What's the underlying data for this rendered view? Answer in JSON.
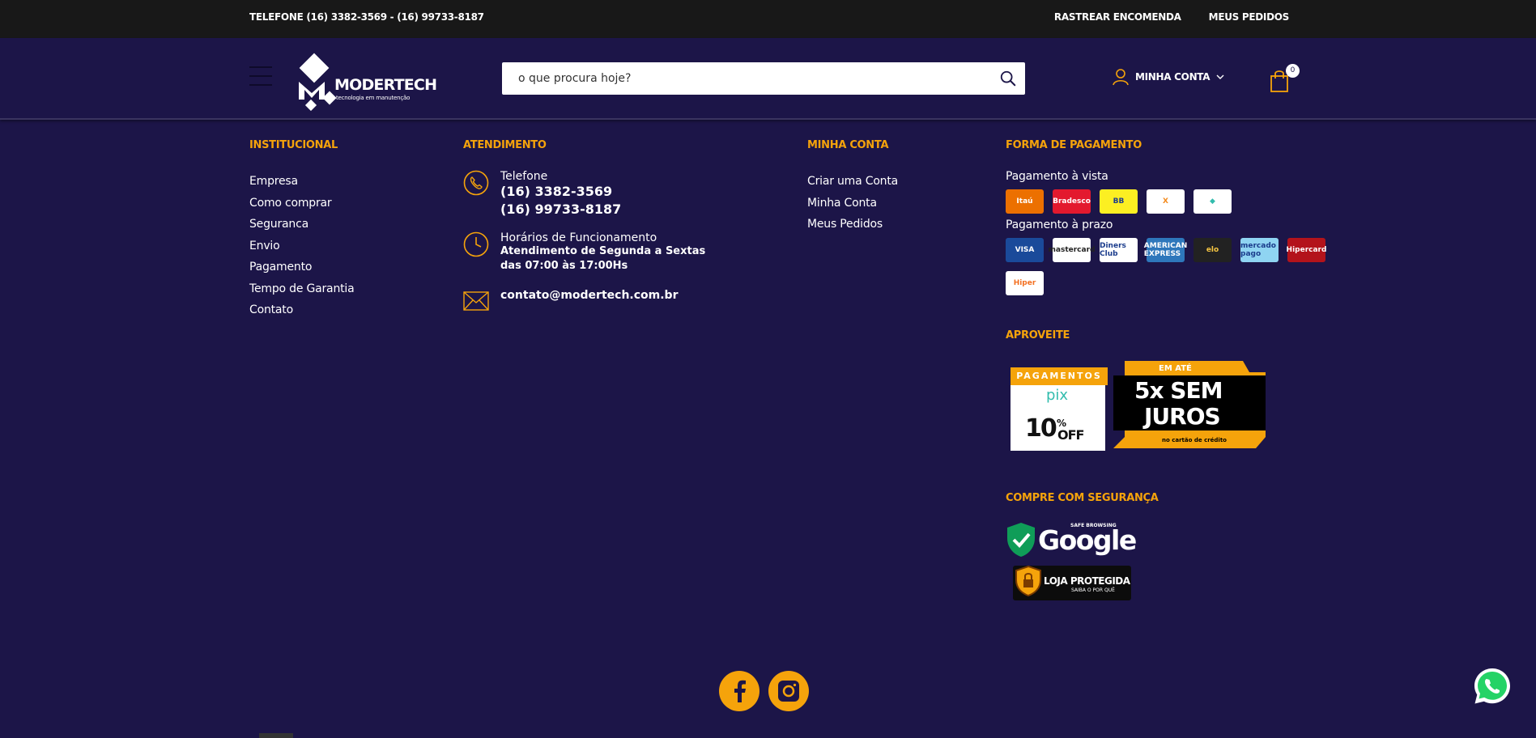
{
  "topbar": {
    "phone": "TELEFONE (16) 3382-3569 - (16) 99733-8187",
    "track_order": "RASTREAR ENCOMENDA",
    "my_orders": "MEUS PEDIDOS"
  },
  "header": {
    "logo_brand": "MODERTECH",
    "logo_tagline": "tecnologia em manutenção",
    "search_placeholder": "o que procura hoje?",
    "account_label": "MINHA CONTA",
    "cart_count": "0"
  },
  "institucional": {
    "title": "INSTITUCIONAL",
    "items": [
      "Empresa",
      "Como comprar",
      "Seguranca",
      "Envio",
      "Pagamento",
      "Tempo de Garantia",
      "Contato"
    ]
  },
  "atendimento": {
    "title": "ATENDIMENTO",
    "phone_label": "Telefone",
    "phone_1": "(16) 3382-3569",
    "phone_2": "(16) 99733-8187",
    "hours_label": "Horários de Funcionamento",
    "hours_line1": "Atendimento de Segunda a Sextas",
    "hours_line2": "das 07:00 às 17:00Hs",
    "email": "contato@modertech.com.br"
  },
  "minha_conta": {
    "title": "MINHA CONTA",
    "items": [
      "Criar uma Conta",
      "Minha Conta",
      "Meus Pedidos"
    ]
  },
  "pagamento": {
    "title": "FORMA DE PAGAMENTO",
    "avista_label": "Pagamento à vista",
    "avista": [
      {
        "name": "Itaú",
        "bg": "#ec7000",
        "fg": "#ffffff"
      },
      {
        "name": "Bradesco",
        "bg": "#e3192e",
        "fg": "#ffffff"
      },
      {
        "name": "BB",
        "bg": "#fcef22",
        "fg": "#1b3c8c"
      },
      {
        "name": "X",
        "bg": "#ffffff",
        "fg": "#f38a1d"
      },
      {
        "name": "◆",
        "bg": "#ffffff",
        "fg": "#32bcad"
      }
    ],
    "prazo_label": "Pagamento à prazo",
    "prazo": [
      {
        "name": "VISA",
        "bg": "#1a4a9a",
        "fg": "#ffffff"
      },
      {
        "name": "mastercard",
        "bg": "#ffffff",
        "fg": "#222222"
      },
      {
        "name": "Diners Club",
        "bg": "#ffffff",
        "fg": "#1b3c8c"
      },
      {
        "name": "AMERICAN EXPRESS",
        "bg": "#2e77bb",
        "fg": "#ffffff"
      },
      {
        "name": "elo",
        "bg": "#222222",
        "fg": "#f5c542"
      },
      {
        "name": "mercado pago",
        "bg": "#8fd4f2",
        "fg": "#1b3c8c"
      },
      {
        "name": "Hipercard",
        "bg": "#b3131b",
        "fg": "#ffffff"
      },
      {
        "name": "Hiper",
        "bg": "#ffffff",
        "fg": "#f37021"
      }
    ]
  },
  "aproveite": {
    "title": "APROVEITE",
    "pix_label": "PAGAMENTOS",
    "pix_brand": "pix",
    "pix_discount": "10",
    "pix_off": "OFF",
    "installments_top": "EM ATÉ",
    "installments_main": "5x SEM",
    "installments_main2": "JUROS",
    "installments_note": "no cartão de crédito"
  },
  "seguranca": {
    "title": "COMPRE COM SEGURANÇA",
    "google_small": "SAFE BROWSING",
    "google": "Google",
    "loja": "LOJA PROTEGIDA",
    "loja_sub": "SAIBA O POR QUÊ"
  },
  "colors": {
    "accent": "#f5a30b",
    "background": "#1c1548",
    "topbar": "#181818"
  }
}
